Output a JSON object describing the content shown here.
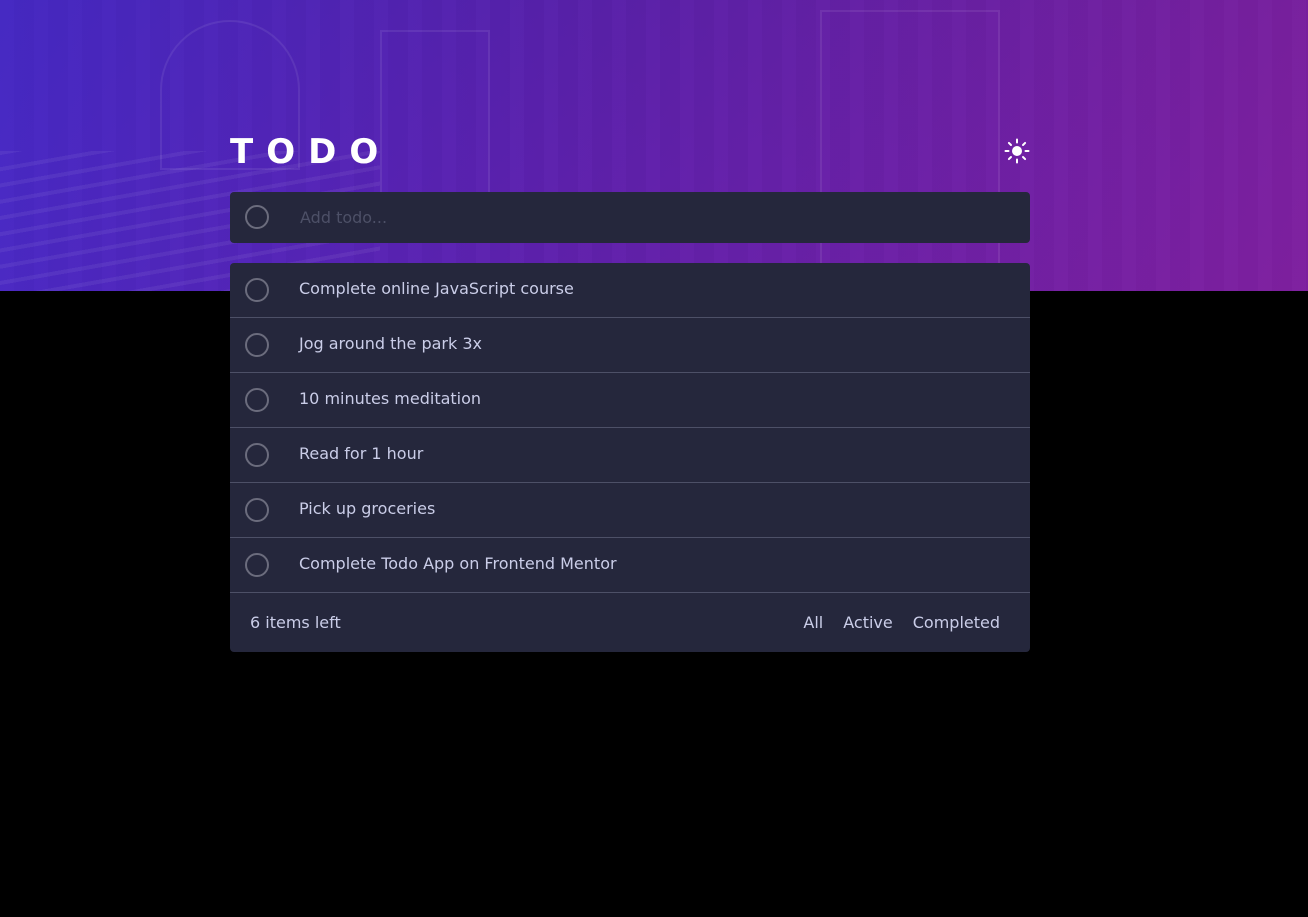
{
  "app": {
    "title": "TODO",
    "theme_icon": "sun-icon"
  },
  "new_todo": {
    "placeholder": "Add todo..."
  },
  "todos": [
    {
      "label": "Complete online JavaScript course"
    },
    {
      "label": "Jog around the park 3x"
    },
    {
      "label": "10 minutes meditation"
    },
    {
      "label": "Read for 1 hour"
    },
    {
      "label": "Pick up groceries"
    },
    {
      "label": "Complete Todo App on Frontend Mentor"
    }
  ],
  "footer": {
    "items_left": "6 items left",
    "filters": [
      "All",
      "Active",
      "Completed"
    ]
  },
  "colors": {
    "card_bg": "#25273c",
    "text": "#cacde8",
    "placeholder": "#4d5067",
    "page_bg": "#000000"
  }
}
